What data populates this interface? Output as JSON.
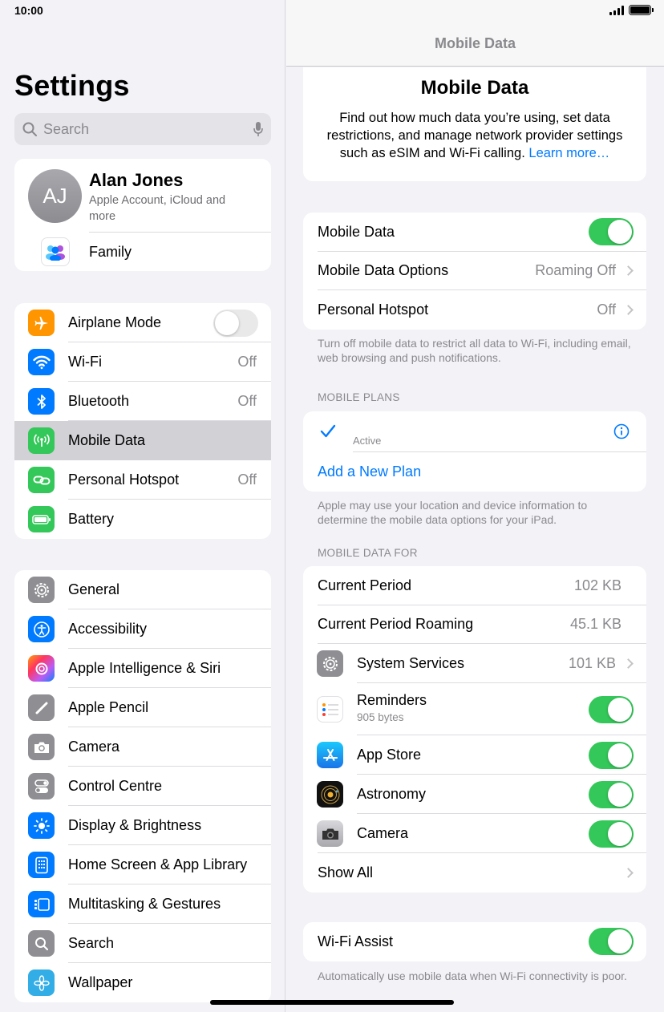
{
  "status": {
    "time": "10:00"
  },
  "sidebar": {
    "title": "Settings",
    "search": {
      "placeholder": "Search"
    },
    "account": {
      "initials": "AJ",
      "name": "Alan Jones",
      "subtitle": "Apple Account, iCloud and more",
      "family_label": "Family"
    },
    "group1": [
      {
        "label": "Airplane Mode",
        "icon": "airplane-icon",
        "color": "#ff9500",
        "toggle": false
      },
      {
        "label": "Wi-Fi",
        "icon": "wifi-icon",
        "color": "#007aff",
        "value": "Off"
      },
      {
        "label": "Bluetooth",
        "icon": "bluetooth-icon",
        "color": "#007aff",
        "value": "Off"
      },
      {
        "label": "Mobile Data",
        "icon": "antenna-icon",
        "color": "#34c759",
        "selected": true
      },
      {
        "label": "Personal Hotspot",
        "icon": "link-icon",
        "color": "#34c759",
        "value": "Off"
      },
      {
        "label": "Battery",
        "icon": "battery-icon",
        "color": "#34c759"
      }
    ],
    "group2": [
      {
        "label": "General",
        "icon": "gear-icon",
        "color": "#8e8e93"
      },
      {
        "label": "Accessibility",
        "icon": "accessibility-icon",
        "color": "#007aff"
      },
      {
        "label": "Apple Intelligence & Siri",
        "icon": "siri-icon",
        "color": "#ff6fa8"
      },
      {
        "label": "Apple Pencil",
        "icon": "pencil-icon",
        "color": "#8e8e93"
      },
      {
        "label": "Camera",
        "icon": "camera-icon",
        "color": "#8e8e93"
      },
      {
        "label": "Control Centre",
        "icon": "switches-icon",
        "color": "#8e8e93"
      },
      {
        "label": "Display & Brightness",
        "icon": "sun-icon",
        "color": "#007aff"
      },
      {
        "label": "Home Screen & App Library",
        "icon": "home-screen-icon",
        "color": "#007aff"
      },
      {
        "label": "Multitasking & Gestures",
        "icon": "multitasking-icon",
        "color": "#007aff"
      },
      {
        "label": "Search",
        "icon": "search-icon",
        "color": "#8e8e93"
      },
      {
        "label": "Wallpaper",
        "icon": "flower-icon",
        "color": "#32ade6"
      }
    ]
  },
  "detail": {
    "nav_title": "Mobile Data",
    "hero": {
      "title": "Mobile Data",
      "description": "Find out how much data you’re using, set data restrictions, and manage network provider settings such as eSIM and Wi-Fi calling.",
      "link": "Learn more…"
    },
    "main_rows": [
      {
        "label": "Mobile Data",
        "toggle": true
      },
      {
        "label": "Mobile Data Options",
        "value": "Roaming Off"
      },
      {
        "label": "Personal Hotspot",
        "value": "Off"
      }
    ],
    "main_footer": "Turn off mobile data to restrict all data to Wi-Fi, including email, web browsing and push notifications.",
    "plans_header": "MOBILE PLANS",
    "plan": {
      "status": "Active",
      "add_label": "Add a New Plan"
    },
    "plans_footer": "Apple may use your location and device information to determine the mobile data options for your iPad.",
    "usage_header": "MOBILE DATA FOR",
    "usage": {
      "current_period_label": "Current Period",
      "current_period_value": "102 KB",
      "roaming_label": "Current Period Roaming",
      "roaming_value": "45.1 KB",
      "system_services_label": "System Services",
      "system_services_value": "101 KB",
      "apps": [
        {
          "label": "Reminders",
          "sub": "905 bytes",
          "icon": "reminders-icon",
          "toggle": true
        },
        {
          "label": "App Store",
          "icon": "app-store-icon",
          "toggle": true
        },
        {
          "label": "Astronomy",
          "icon": "astronomy-icon",
          "toggle": true
        },
        {
          "label": "Camera",
          "icon": "camera-icon",
          "toggle": true
        }
      ],
      "show_all": "Show All"
    },
    "wifi_assist": {
      "label": "Wi-Fi Assist",
      "toggle": true,
      "footer": "Automatically use mobile data when Wi-Fi connectivity is poor."
    }
  }
}
